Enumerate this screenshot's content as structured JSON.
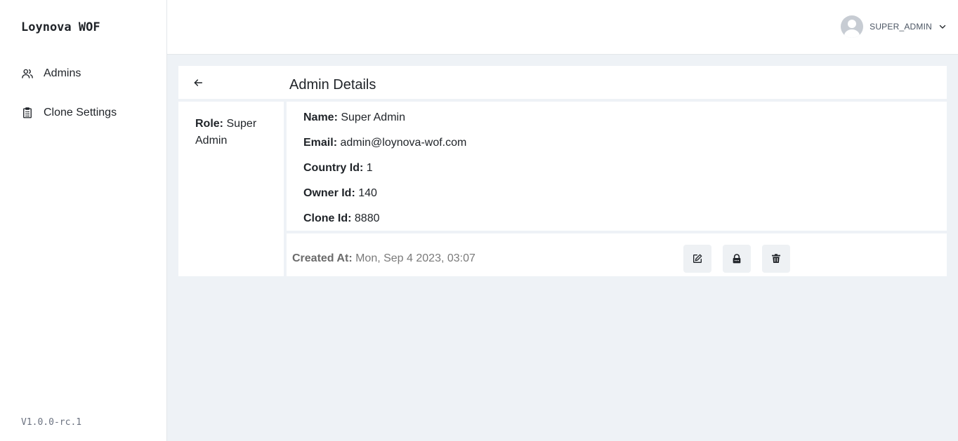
{
  "sidebar": {
    "brand": "Loynova WOF",
    "items": [
      {
        "label": "Admins",
        "icon": "users-icon"
      },
      {
        "label": "Clone Settings",
        "icon": "clipboard-icon"
      }
    ],
    "version": "V1.0.0-rc.1"
  },
  "topbar": {
    "user_name": "SUPER_ADMIN"
  },
  "header": {
    "title": "Admin Details"
  },
  "role": {
    "label": "Role:",
    "value": "Super Admin"
  },
  "details": {
    "name_label": "Name:",
    "name_value": "Super Admin",
    "email_label": "Email:",
    "email_value": "admin@loynova-wof.com",
    "country_label": "Country Id:",
    "country_value": "1",
    "owner_label": "Owner Id:",
    "owner_value": "140",
    "clone_label": "Clone Id:",
    "clone_value": "8880"
  },
  "footer": {
    "created_label": "Created At:",
    "created_value": "Mon, Sep 4 2023, 03:07"
  },
  "colors": {
    "background": "#eef2f6",
    "card": "#ffffff",
    "text": "#1f2328",
    "muted": "#7a7a7a"
  }
}
